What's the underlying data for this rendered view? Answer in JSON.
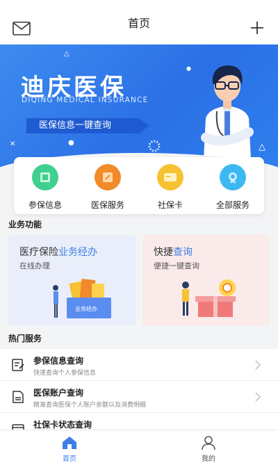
{
  "header": {
    "title": "首页",
    "left_icon": "mail-icon",
    "right_icon": "plus-icon"
  },
  "banner": {
    "brand": "迪庆医保",
    "brand_en": "DIQING MEDICAL INSURANCE",
    "tagline": "医保信息一键查询"
  },
  "quick_services": [
    {
      "label": "参保信息",
      "icon": "id-card-icon",
      "color": "#3fcf8e"
    },
    {
      "label": "医保服务",
      "icon": "edit-document-icon",
      "color": "#f08a2a"
    },
    {
      "label": "社保卡",
      "icon": "card-icon",
      "color": "#f6c233"
    },
    {
      "label": "全部服务",
      "icon": "badge-icon",
      "color": "#3cb8f2"
    }
  ],
  "business": {
    "section_title": "业务功能",
    "cards": [
      {
        "title_plain": "医疗保险",
        "title_highlight": "业务经办",
        "subtitle": "在线办理",
        "bin_label": "业务经办",
        "bg": "#e9eefa"
      },
      {
        "title_plain": "快捷",
        "title_highlight": "查询",
        "subtitle": "便捷一键查询",
        "bg": "#fbeaea"
      }
    ]
  },
  "hot": {
    "section_title": "热门服务",
    "items": [
      {
        "title": "参保信息查询",
        "subtitle": "快速查询个人参保信息",
        "icon": "edit-list-icon"
      },
      {
        "title": "医保账户查询",
        "subtitle": "精准查询医保个人账户余额以及消费明细",
        "icon": "document-icon"
      },
      {
        "title": "社保卡状态查询",
        "subtitle": "",
        "icon": "card-status-icon"
      }
    ]
  },
  "tabbar": {
    "tabs": [
      {
        "label": "首页",
        "icon": "home-icon",
        "active": true,
        "color": "#3f7ee8"
      },
      {
        "label": "我的",
        "icon": "user-icon",
        "active": false,
        "color": "#555555"
      }
    ]
  }
}
